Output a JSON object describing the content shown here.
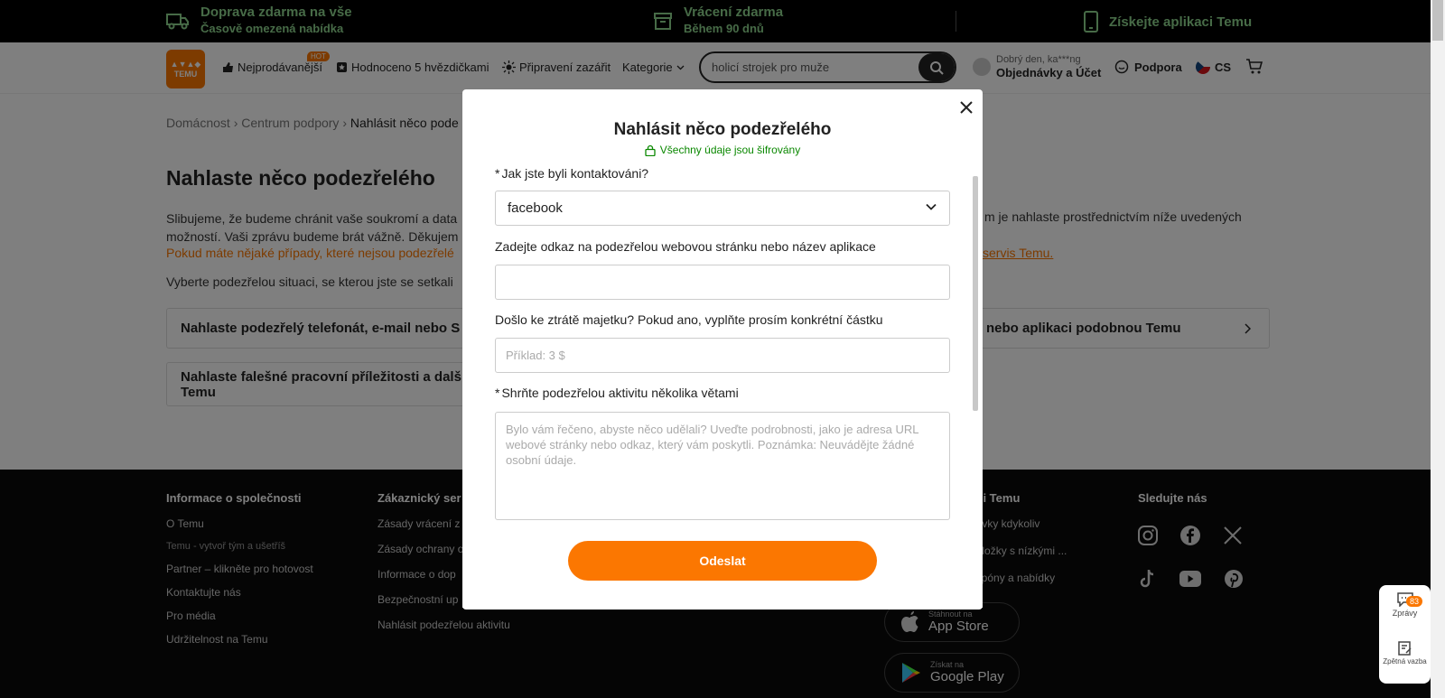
{
  "topbar": {
    "shipping_l1": "Doprava zdarma na vše",
    "shipping_l2": "Časově omezená nabídka",
    "returns_l1": "Vrácení zdarma",
    "returns_l2": "Během 90 dnů",
    "app": "Získejte aplikaci Temu"
  },
  "header": {
    "logo": "TEMU",
    "nav": [
      "Nejprodávanější",
      "Hodnoceno 5 hvězdičkami",
      "Připravení zazářit",
      "Kategorie"
    ],
    "hot_badge": "HOT",
    "search_value": "holicí strojek pro muže",
    "greeting": "Dobrý den, ka***ng",
    "orders": "Objednávky a Účet",
    "support": "Podpora",
    "lang": "CS"
  },
  "breadcrumb": [
    "Domácnost",
    "Centrum podpory",
    "Nahlásit něco pode"
  ],
  "page": {
    "title": "Nahlaste něco podezřelého",
    "p1_line1": "Slibujeme, že budeme chránit vaše soukromí a data",
    "p1_line2": "možností. Vaši zprávu budeme brát vážně. Děkujem",
    "p1_right": "m je nahlaste prostřednictvím níže uvedených",
    "p2": "Pokud máte nějaké případy, které nejsou podezřelé",
    "p2_right": "servis Temu.",
    "p3": "Vyberte podezřelou situaci, se kterou jste se setkali",
    "card1": "Nahlaste podezřelý telefonát, e-mail nebo S",
    "card2_l1": "Nahlaste falešné pracovní příležitosti a dalš",
    "card2_l2": "Temu",
    "card3": "nebo aplikaci podobnou Temu"
  },
  "footer": {
    "col1_title": "Informace o společnosti",
    "col1": [
      "O Temu",
      "Temu - vytvoř tým a ušetříš",
      "Partner – klikněte pro hotovost",
      "Kontaktujte nás",
      "Pro média",
      "Udržitelnost na Temu"
    ],
    "col2_title": "Zákaznický ser",
    "col2": [
      "Zásady vrácení z",
      "Zásady ochrany o",
      "Informace o dop",
      "Bezpečnostní up",
      "Nahlásit podezřelou aktivitu"
    ],
    "col3_title": "aci Temu",
    "col3": [
      "návky kdykoliv",
      "položky s nízkými ...",
      "kupóny a nabídky"
    ],
    "col4_title": "Sledujte nás",
    "appstore_small": "Stáhnout na",
    "appstore": "App Store",
    "gplay_small": "Získat na",
    "gplay": "Google Play"
  },
  "side_widget": {
    "badge": "83",
    "messages": "Zprávy",
    "feedback": "Zpětná vazba"
  },
  "modal": {
    "title": "Nahlásit něco podezřelého",
    "encrypted": "Všechny údaje jsou šifrovány",
    "q1_label": "Jak jste byli kontaktováni?",
    "q1_value": "facebook",
    "q2_label": "Zadejte odkaz na podezřelou webovou stránku nebo název aplikace",
    "q2_value": "",
    "q3_label": "Došlo ke ztrátě majetku? Pokud ano, vyplňte prosím konkrétní částku",
    "q3_placeholder": "Příklad: 3 $",
    "q4_label": "Shrňte podezřelou aktivitu několika větami",
    "q4_placeholder": "Bylo vám řečeno, abyste něco udělali? Uveďte podrobnosti, jako je adresa URL webové stránky nebo odkaz, který vám poskytli. Poznámka: Neuvádějte žádné osobní údaje.",
    "submit": "Odeslat",
    "required_mark": "*"
  },
  "colors": {
    "accent": "#fb7701",
    "green": "#0a8800",
    "topbar_green": "#8fd68f"
  }
}
